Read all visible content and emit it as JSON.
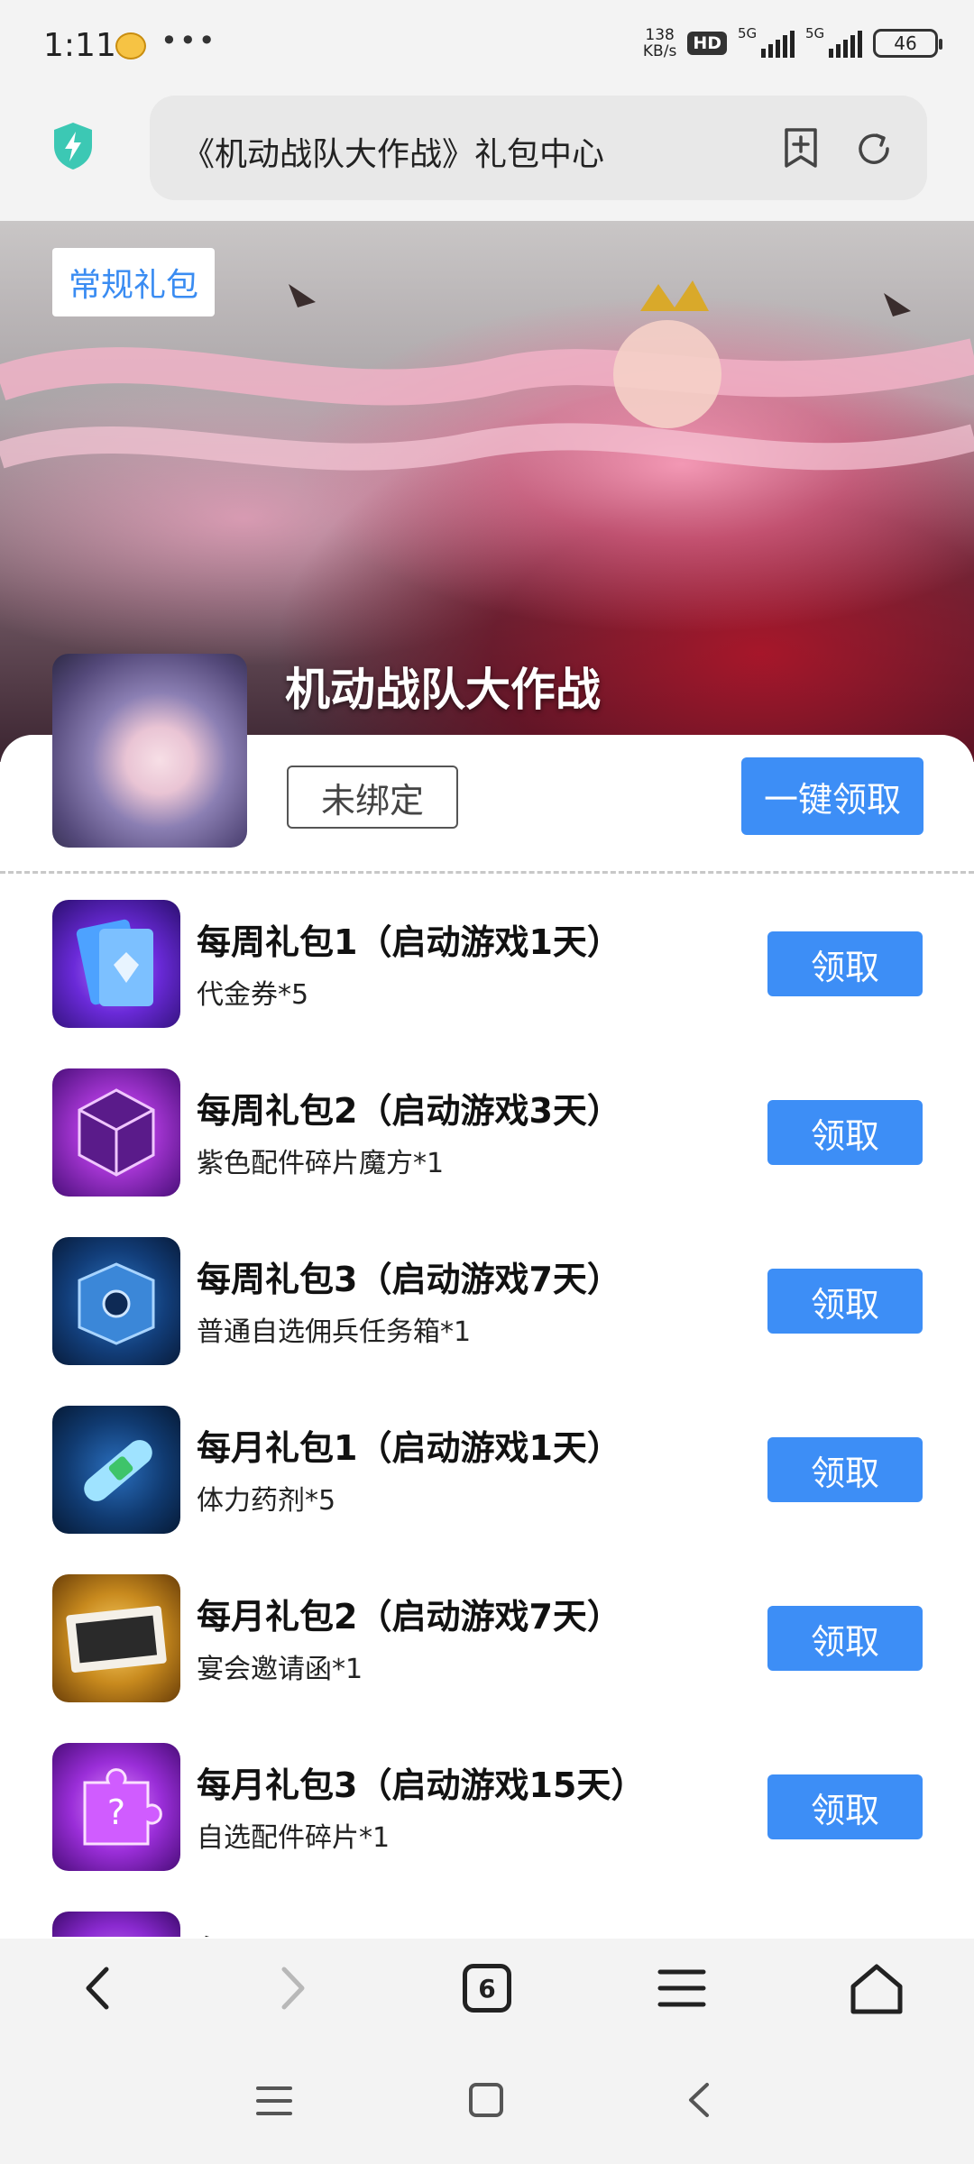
{
  "status": {
    "time": "1:11",
    "dots": "•••",
    "speed_top": "138",
    "speed_unit": "KB/s",
    "hd": "HD",
    "net1": "5G",
    "net2": "5G",
    "battery": "46"
  },
  "browser": {
    "url_text": "《机动战队大作战》礼包中心"
  },
  "banner": {
    "tag": "常规礼包",
    "game_title": "机动战队大作战"
  },
  "header": {
    "unbound_label": "未绑定",
    "claim_all_label": "一键领取"
  },
  "gifts": [
    {
      "title": "每周礼包1（启动游戏1天）",
      "sub": "代金券*5",
      "button": "领取"
    },
    {
      "title": "每周礼包2（启动游戏3天）",
      "sub": "紫色配件碎片魔方*1",
      "button": "领取"
    },
    {
      "title": "每周礼包3（启动游戏7天）",
      "sub": "普通自选佣兵任务箱*1",
      "button": "领取"
    },
    {
      "title": "每月礼包1（启动游戏1天）",
      "sub": "体力药剂*5",
      "button": "领取"
    },
    {
      "title": "每月礼包2（启动游戏7天）",
      "sub": "宴会邀请函*1",
      "button": "领取"
    },
    {
      "title": "每月礼包3（启动游戏15天）",
      "sub": "自选配件碎片*1",
      "button": "领取"
    },
    {
      "title": "每月",
      "sub": "",
      "button": ""
    }
  ],
  "nav": {
    "tab_count": "6"
  },
  "colors": {
    "accent": "#3d8ef6",
    "tag_text": "#3a8cf2",
    "shield": "#3cc8b4"
  }
}
